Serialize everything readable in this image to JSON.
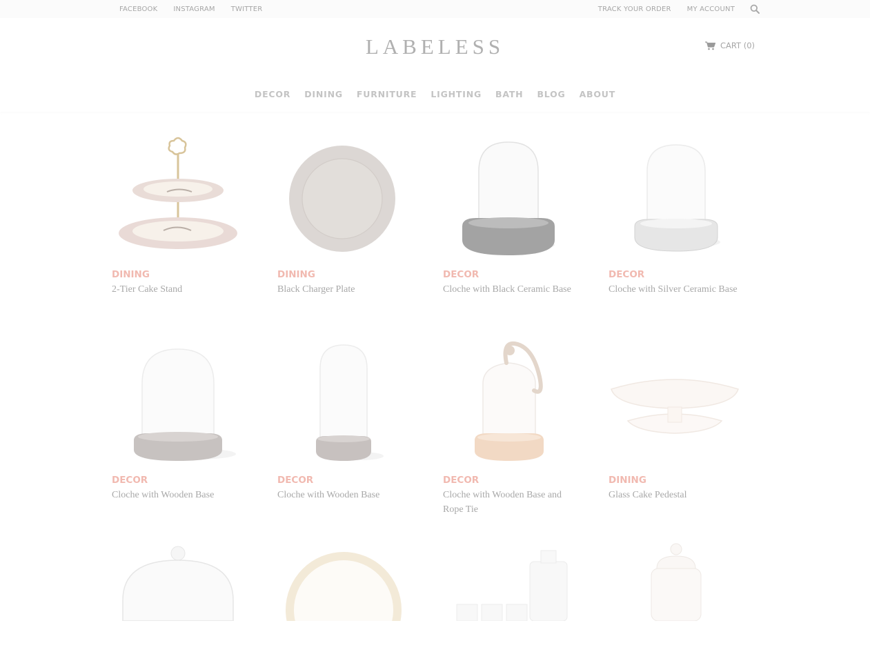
{
  "topbar": {
    "social": [
      "FACEBOOK",
      "INSTAGRAM",
      "TWITTER"
    ],
    "account_links": [
      "TRACK YOUR ORDER",
      "MY ACCOUNT"
    ],
    "search_icon": "search-icon"
  },
  "header": {
    "logo": "LABELESS",
    "cart_label": "CART (0)",
    "cart_icon": "shopping-cart-icon"
  },
  "nav": [
    "DECOR",
    "DINING",
    "FURNITURE",
    "LIGHTING",
    "BATH",
    "BLOG",
    "ABOUT"
  ],
  "colors": {
    "category": "#f1b9b0",
    "text": "#a8a8a8",
    "nav": "#c4c4c4",
    "topbar_bg": "#fbfbfb"
  },
  "products": [
    {
      "category": "DINING",
      "title": "2-Tier Cake Stand",
      "image": "cake-stand"
    },
    {
      "category": "DINING",
      "title": "Black Charger Plate",
      "image": "charger-plate"
    },
    {
      "category": "DECOR",
      "title": "Cloche with Black Ceramic Base",
      "image": "cloche-black"
    },
    {
      "category": "DECOR",
      "title": "Cloche with Silver Ceramic Base",
      "image": "cloche-silver"
    },
    {
      "category": "DECOR",
      "title": "Cloche with Wooden Base",
      "image": "cloche-wood-wide"
    },
    {
      "category": "DECOR",
      "title": "Cloche with Wooden Base",
      "image": "cloche-wood-tall"
    },
    {
      "category": "DECOR",
      "title": "Cloche with Wooden Base and Rope Tie",
      "image": "cloche-rope"
    },
    {
      "category": "DINING",
      "title": "Glass Cake Pedestal",
      "image": "cake-pedestal"
    },
    {
      "category": "",
      "title": "",
      "image": "glass-dome"
    },
    {
      "category": "",
      "title": "",
      "image": "gold-plate"
    },
    {
      "category": "",
      "title": "",
      "image": "decanter-set"
    },
    {
      "category": "",
      "title": "",
      "image": "apothecary-jar"
    }
  ]
}
